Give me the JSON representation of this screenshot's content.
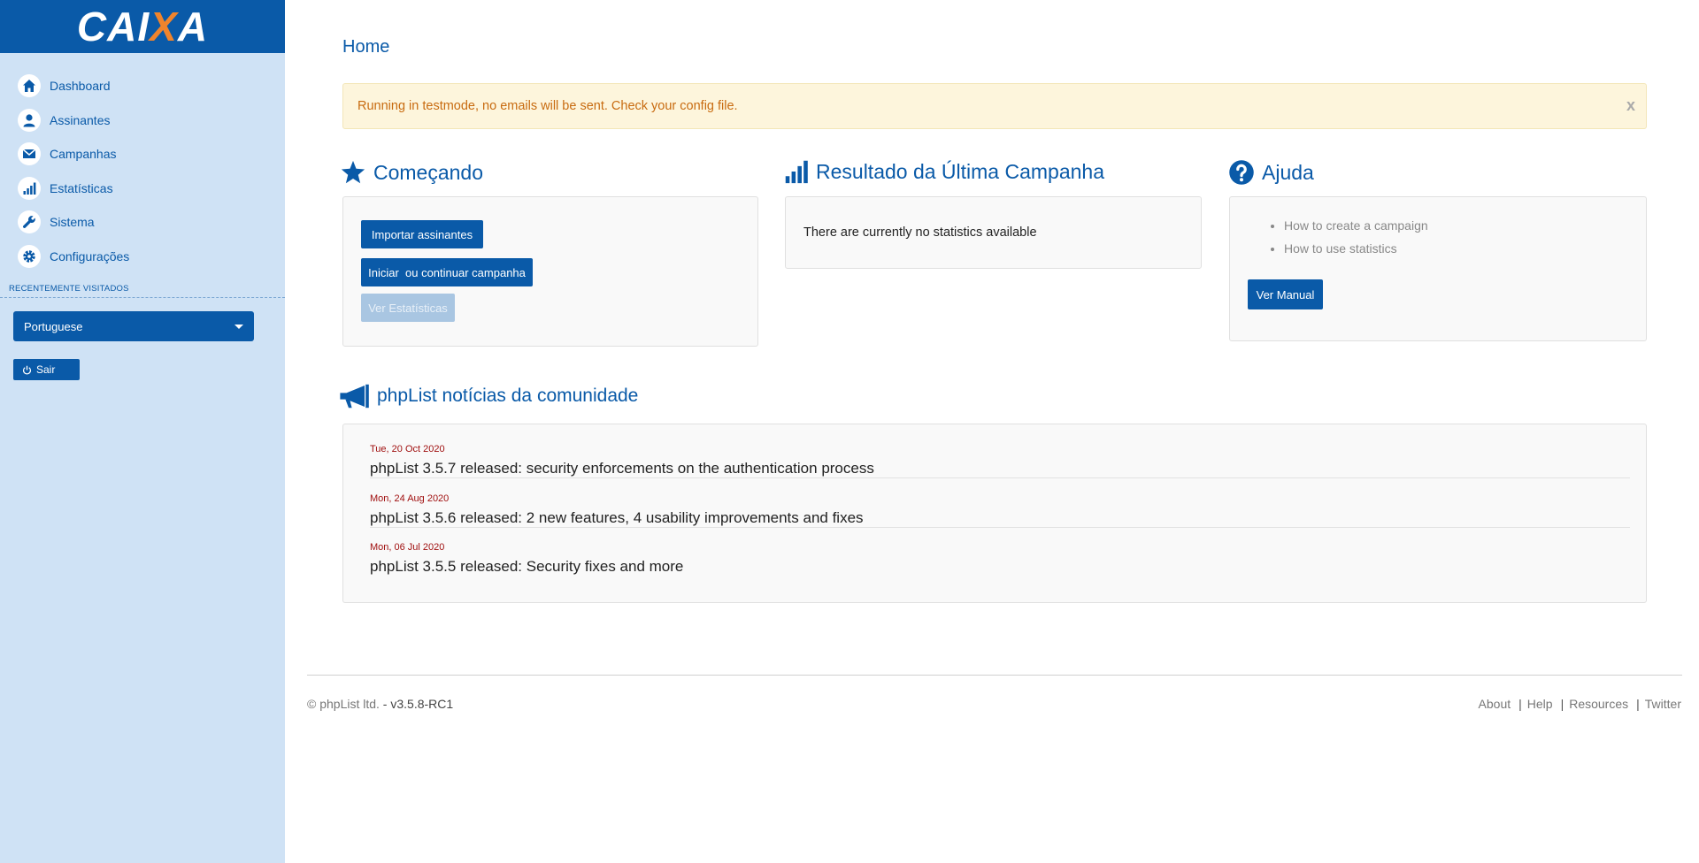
{
  "logo": {
    "left": "CAI",
    "x": "X",
    "right": "A"
  },
  "nav": [
    {
      "label": "Dashboard",
      "icon": "home-icon"
    },
    {
      "label": "Assinantes",
      "icon": "user-icon"
    },
    {
      "label": "Campanhas",
      "icon": "envelope-icon"
    },
    {
      "label": "Estatísticas",
      "icon": "bar-chart-icon"
    },
    {
      "label": "Sistema",
      "icon": "wrench-icon"
    },
    {
      "label": "Configurações",
      "icon": "gear-icon"
    }
  ],
  "recent_heading": "RECENTEMENTE VISITADOS",
  "language_selected": "Portuguese",
  "logout_label": "Sair",
  "page_title": "Home",
  "alert": {
    "text": "Running in testmode, no emails will be sent. Check your config file.",
    "close": "x"
  },
  "getting_started": {
    "heading": "Começando",
    "buttons": [
      "Importar assinantes",
      "Iniciar  ou continuar campanha",
      "Ver Estatísticas"
    ]
  },
  "last_campaign": {
    "heading": "Resultado da Última Campanha",
    "text": "There are currently no statistics available"
  },
  "help": {
    "heading": "Ajuda",
    "links": [
      "How to create a campaign",
      "How to use statistics"
    ],
    "button": "Ver Manual"
  },
  "news": {
    "heading": "phpList notícias da comunidade",
    "items": [
      {
        "date": "Tue, 20 Oct 2020",
        "title": "phpList 3.5.7 released: security enforcements on the authentication process"
      },
      {
        "date": "Mon, 24 Aug 2020",
        "title": "phpList 3.5.6 released: 2 new features, 4 usability improvements and fixes"
      },
      {
        "date": "Mon, 06 Jul 2020",
        "title": "phpList 3.5.5 released: Security fixes and more"
      }
    ]
  },
  "footer": {
    "copyright": "© phpList ltd.",
    "version": " - v3.5.8-RC1",
    "links": [
      "About",
      "Help",
      "Resources",
      "Twitter"
    ],
    "separator": "|"
  },
  "colors": {
    "brand": "#0a5aa8",
    "sidebar": "#cfe2f5",
    "alert_text": "#c86b10",
    "news_date": "#a01010",
    "logo_x": "#f0842c"
  }
}
